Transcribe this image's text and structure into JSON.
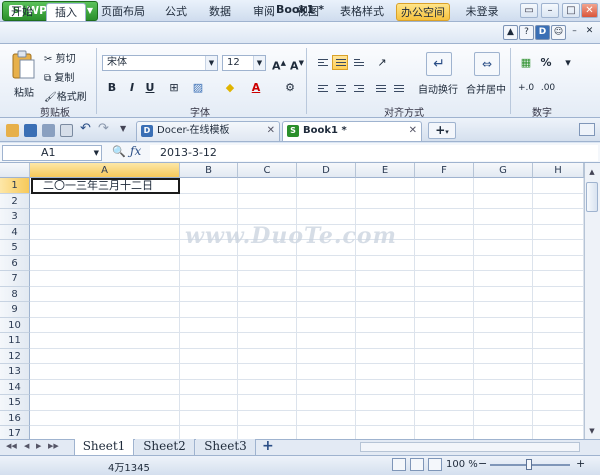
{
  "app": {
    "name": "WPS 表格",
    "document_title": "Book1 *"
  },
  "menu": {
    "tabs": [
      "开始",
      "插入",
      "页面布局",
      "公式",
      "数据",
      "审阅",
      "视图",
      "表格样式",
      "办公空间"
    ],
    "login": "未登录"
  },
  "ribbon": {
    "paste": "粘贴",
    "cut": "剪切",
    "copy": "复制",
    "format_painter": "格式刷",
    "clipboard_group": "剪贴板",
    "font_name": "宋体",
    "font_size": "12",
    "bold": "B",
    "italic": "I",
    "underline": "U",
    "font_group": "字体",
    "wrap_text": "自动换行",
    "merge_center": "合并居中",
    "align_group": "对齐方式",
    "number_format": "%",
    "number_group": "数字"
  },
  "doc_tabs": [
    {
      "label": "Docer-在线模板",
      "icon": "D"
    },
    {
      "label": "Book1 *",
      "icon": "S"
    }
  ],
  "formula_bar": {
    "name_box": "A1",
    "formula": "2013-3-12"
  },
  "grid": {
    "columns": [
      "A",
      "B",
      "C",
      "D",
      "E",
      "F",
      "G",
      "H"
    ],
    "rows": [
      "1",
      "2",
      "3",
      "4",
      "5",
      "6",
      "7",
      "8",
      "9",
      "10",
      "11",
      "12",
      "13",
      "14",
      "15",
      "16",
      "17"
    ],
    "active_cell_value": "二〇一三年三月十二日"
  },
  "sheets": [
    "Sheet1",
    "Sheet2",
    "Sheet3"
  ],
  "status": {
    "text": "4万1345",
    "zoom": "100 %"
  },
  "watermark": "www.DuoTe.com",
  "colors": {
    "accent_green": "#2a8f2a",
    "active_tab_yellow": "#f7c95a",
    "ribbon_border": "#9fb3cf"
  }
}
